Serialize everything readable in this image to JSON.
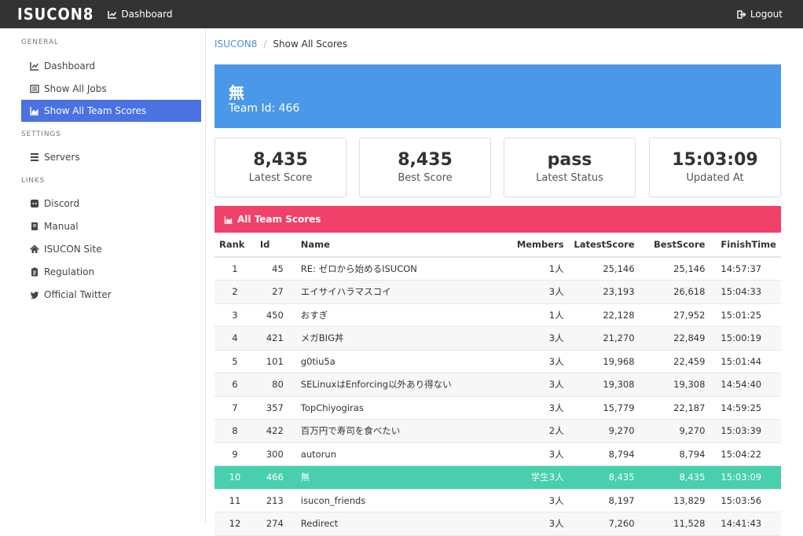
{
  "navbar": {
    "brand": "ISUCON8",
    "dashboard_label": "Dashboard",
    "logout_label": "Logout"
  },
  "sidebar": {
    "sections": [
      {
        "title": "GENERAL",
        "items": [
          {
            "label": "Dashboard",
            "icon": "chart-line-icon"
          },
          {
            "label": "Show All Jobs",
            "icon": "list-icon"
          },
          {
            "label": "Show All Team Scores",
            "icon": "chart-area-icon",
            "active": true
          }
        ]
      },
      {
        "title": "SETTINGS",
        "items": [
          {
            "label": "Servers",
            "icon": "server-icon"
          }
        ]
      },
      {
        "title": "LINKS",
        "items": [
          {
            "label": "Discord",
            "icon": "discord-icon"
          },
          {
            "label": "Manual",
            "icon": "book-icon"
          },
          {
            "label": "ISUCON Site",
            "icon": "home-icon"
          },
          {
            "label": "Regulation",
            "icon": "clipboard-icon"
          },
          {
            "label": "Official Twitter",
            "icon": "twitter-icon"
          }
        ]
      }
    ]
  },
  "breadcrumb": {
    "root": "ISUCON8",
    "separator": "/",
    "current": "Show All Scores"
  },
  "hero": {
    "team_mark": "無",
    "team_id": "Team Id: 466"
  },
  "stats": [
    {
      "value": "8,435",
      "label": "Latest Score"
    },
    {
      "value": "8,435",
      "label": "Best Score"
    },
    {
      "value": "pass",
      "label": "Latest Status"
    },
    {
      "value": "15:03:09",
      "label": "Updated At"
    }
  ],
  "scores": {
    "title": "All Team Scores",
    "columns": [
      "Rank",
      "Id",
      "Name",
      "Members",
      "LatestScore",
      "BestScore",
      "FinishTime"
    ],
    "rows": [
      [
        "1",
        "45",
        "RE: ゼロから始めるISUCON",
        "1人",
        "25,146",
        "25,146",
        "14:57:37"
      ],
      [
        "2",
        "27",
        "エイサイハラマスコイ",
        "3人",
        "23,193",
        "26,618",
        "15:04:33"
      ],
      [
        "3",
        "450",
        "おすぎ",
        "1人",
        "22,128",
        "27,952",
        "15:01:25"
      ],
      [
        "4",
        "421",
        "メガBIG丼",
        "3人",
        "21,270",
        "22,849",
        "15:00:19"
      ],
      [
        "5",
        "101",
        "g0tiu5a",
        "3人",
        "19,968",
        "22,459",
        "15:01:44"
      ],
      [
        "6",
        "80",
        "SELinuxはEnforcing以外あり得ない",
        "3人",
        "19,308",
        "19,308",
        "14:54:40"
      ],
      [
        "7",
        "357",
        "TopChiyogiras",
        "3人",
        "15,779",
        "22,187",
        "14:59:25"
      ],
      [
        "8",
        "422",
        "百万円で寿司を食べたい",
        "2人",
        "9,270",
        "9,270",
        "15:03:39"
      ],
      [
        "9",
        "300",
        "autorun",
        "3人",
        "8,794",
        "8,794",
        "15:04:22"
      ],
      [
        "10",
        "466",
        "無",
        "学生3人",
        "8,435",
        "8,435",
        "15:03:09"
      ],
      [
        "11",
        "213",
        "isucon_friends",
        "3人",
        "8,197",
        "13,829",
        "15:03:56"
      ],
      [
        "12",
        "274",
        "Redirect",
        "3人",
        "7,260",
        "11,528",
        "14:41:43"
      ]
    ],
    "highlight_row": 9
  },
  "colors": {
    "navbar": "#333333",
    "sidebar_active": "#4a72e0",
    "hero": "#4a98e8",
    "panel_head": "#f0416a",
    "highlight_row": "#47cfae"
  }
}
